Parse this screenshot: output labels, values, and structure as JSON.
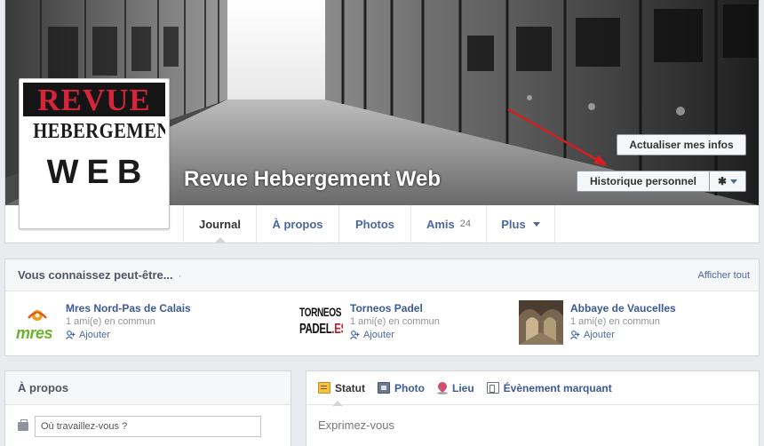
{
  "page": {
    "name": "Revue Hebergement Web",
    "logo": {
      "line1": "REVUE",
      "line2": "HEBERGEMENT",
      "line3": "WEB"
    }
  },
  "actions": {
    "update_info": "Actualiser mes infos",
    "activity_log": "Historique personnel",
    "gear_icon": "gear-icon"
  },
  "tabs": [
    {
      "label": "Journal",
      "active": true
    },
    {
      "label": "À propos"
    },
    {
      "label": "Photos"
    },
    {
      "label": "Amis",
      "count": "24"
    },
    {
      "label": "Plus"
    }
  ],
  "suggestions": {
    "title": "Vous connaissez peut-être...",
    "dot": "·",
    "see_all": "Afficher tout",
    "items": [
      {
        "name": "Mres Nord-Pas de Calais",
        "mutual": "1 ami(e) en commun",
        "add": "Ajouter",
        "thumb_text": "mres"
      },
      {
        "name": "Torneos Padel",
        "mutual": "1 ami(e) en commun",
        "add": "Ajouter",
        "thumb_line1": "TORNEOS",
        "thumb_line2a": "PADEL",
        "thumb_line2b": ".ES"
      },
      {
        "name": "Abbaye de Vaucelles",
        "mutual": "1 ami(e) en commun",
        "add": "Ajouter"
      }
    ]
  },
  "about": {
    "title": "À propos",
    "work_placeholder": "Où travaillez-vous ?"
  },
  "composer": {
    "tabs": [
      {
        "label": "Statut",
        "icon": "status-icon",
        "active": true
      },
      {
        "label": "Photo",
        "icon": "photo-icon"
      },
      {
        "label": "Lieu",
        "icon": "place-icon"
      },
      {
        "label": "Évènement marquant",
        "icon": "milestone-icon"
      }
    ],
    "placeholder": "Exprimez-vous"
  },
  "colors": {
    "link": "#4b67a1",
    "name_link": "#3b5998",
    "background": "#e9ebee",
    "logo_red": "#d6243b",
    "arrow_red": "#d31f1f"
  }
}
